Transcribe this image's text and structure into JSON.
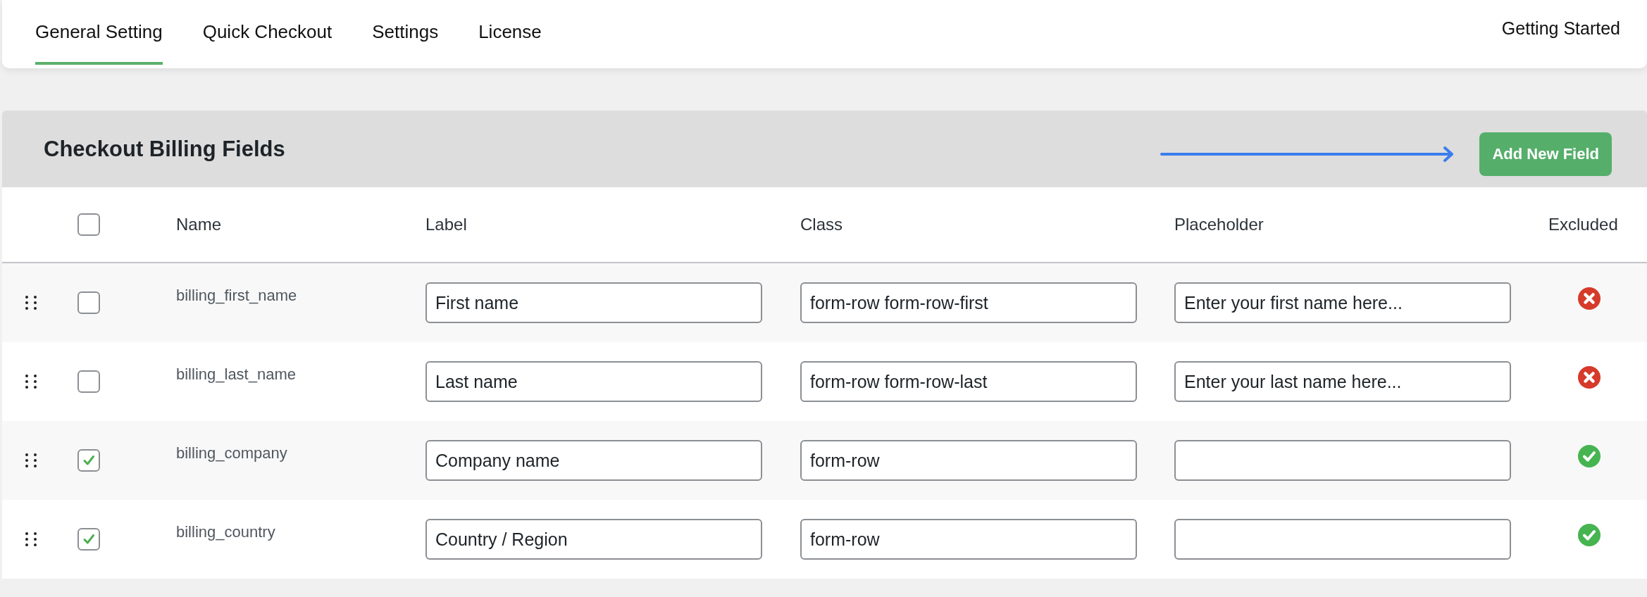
{
  "tabs": [
    {
      "label": "General Setting",
      "selected": true
    },
    {
      "label": "Quick Checkout",
      "selected": false
    },
    {
      "label": "Settings",
      "selected": false
    },
    {
      "label": "License",
      "selected": false
    }
  ],
  "help_link": "Getting Started",
  "panel": {
    "title": "Checkout Billing Fields",
    "add_button": "Add New Field"
  },
  "table": {
    "select_all_checked": false,
    "columns": [
      "Name",
      "Label",
      "Class",
      "Placeholder",
      "Excluded"
    ],
    "rows": [
      {
        "checked": false,
        "name": "billing_first_name",
        "label": {
          "value": "First name"
        },
        "class": {
          "value": "form-row form-row-first"
        },
        "placeholder": {
          "value": "Enter your first name here..."
        },
        "excluded": false
      },
      {
        "checked": false,
        "name": "billing_last_name",
        "label": {
          "value": "Last name"
        },
        "class": {
          "value": "form-row form-row-last"
        },
        "placeholder": {
          "value": "Enter your last name here..."
        },
        "excluded": false
      },
      {
        "checked": true,
        "name": "billing_company",
        "label": {
          "value": "Company name"
        },
        "class": {
          "value": "form-row"
        },
        "placeholder": {},
        "excluded": true
      },
      {
        "checked": true,
        "name": "billing_country",
        "label": {
          "value": "Country / Region"
        },
        "class": {
          "value": "form-row"
        },
        "placeholder": {},
        "excluded": true
      }
    ]
  }
}
